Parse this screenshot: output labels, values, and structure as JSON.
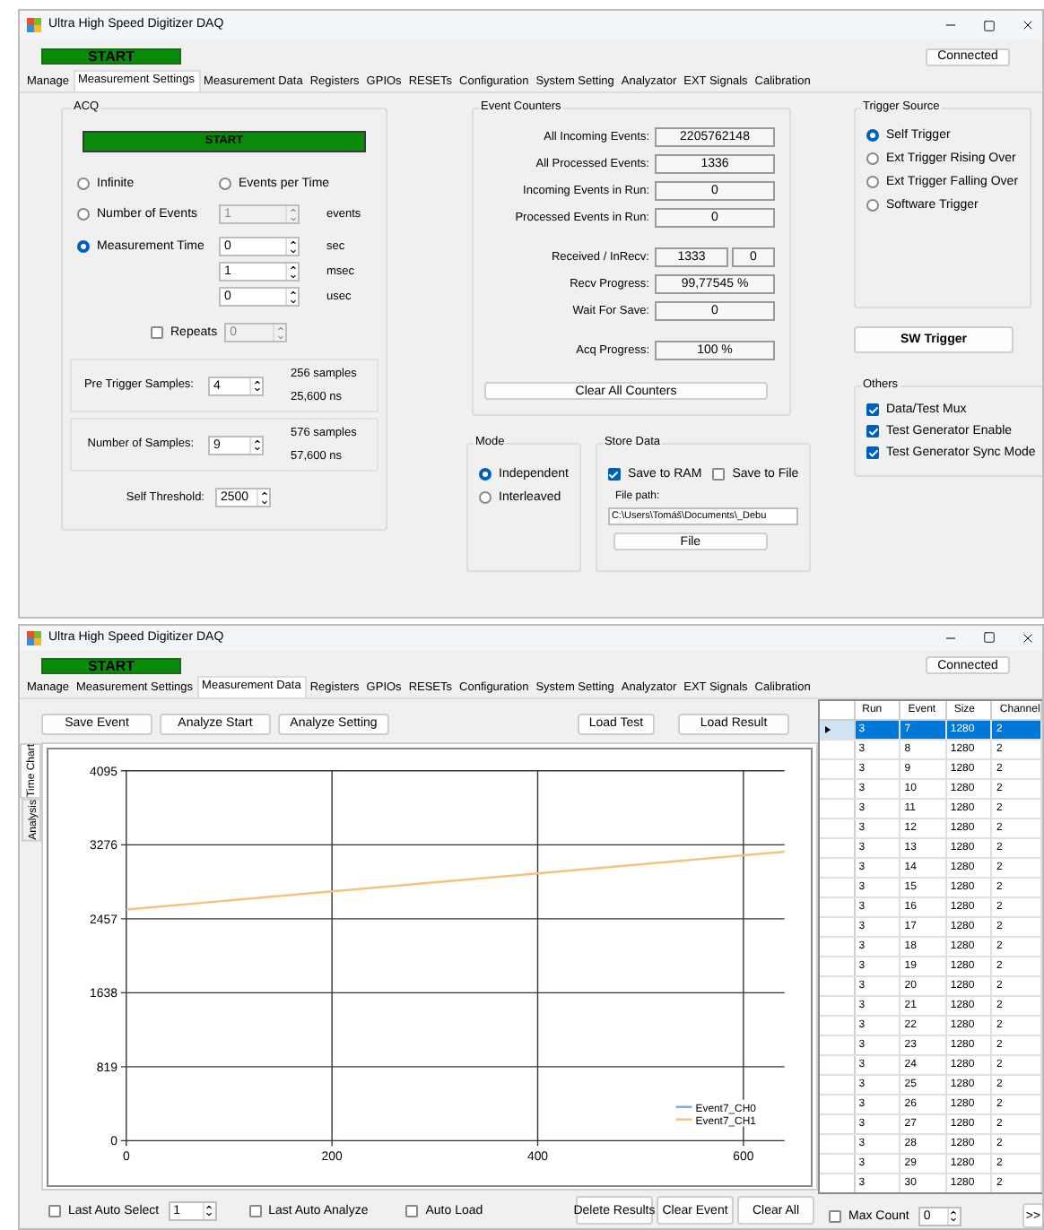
{
  "settings_window": {
    "title": "Ultra High Speed Digitizer DAQ",
    "start_button": "START",
    "connection_button": "Connected",
    "tabs": [
      {
        "label": "Manage",
        "selected": false
      },
      {
        "label": "Measurement Settings",
        "selected": true
      },
      {
        "label": "Measurement Data",
        "selected": false
      },
      {
        "label": "Registers",
        "selected": false
      },
      {
        "label": "GPIOs",
        "selected": false
      },
      {
        "label": "RESETs",
        "selected": false
      },
      {
        "label": "Configuration",
        "selected": false
      },
      {
        "label": "System Setting",
        "selected": false
      },
      {
        "label": "Analyzator",
        "selected": false
      },
      {
        "label": "EXT Signals",
        "selected": false
      },
      {
        "label": "Calibration",
        "selected": false
      }
    ],
    "acq": {
      "title": "ACQ",
      "start_button": "START",
      "modes": [
        {
          "label": "Infinite",
          "selected": false
        },
        {
          "label": "Events per Time",
          "selected": false
        },
        {
          "label": "Number of Events",
          "selected": false
        },
        {
          "label": "Measurement Time",
          "selected": true
        }
      ],
      "number_of_events": {
        "value": "1",
        "unit": "events",
        "disabled": true
      },
      "time": [
        {
          "value": "0",
          "unit": "sec"
        },
        {
          "value": "1",
          "unit": "msec"
        },
        {
          "value": "0",
          "unit": "usec"
        }
      ],
      "repeats": {
        "label": "Repeats",
        "checked": false,
        "value": "0",
        "disabled": true
      },
      "sample_boxes": [
        {
          "label": "Pre Trigger Samples:",
          "value": "4",
          "samples": "256 samples",
          "time": "25,600 ns"
        },
        {
          "label": "Number of Samples:",
          "value": "9",
          "samples": "576 samples",
          "time": "57,600 ns"
        }
      ],
      "threshold": {
        "label": "Self Threshold:",
        "value": "2500"
      }
    },
    "event_counters": {
      "title": "Event Counters",
      "groups": [
        [
          {
            "label": "All Incoming Events:",
            "values": [
              "2205762148"
            ]
          },
          {
            "label": "All Processed Events:",
            "values": [
              "1336"
            ]
          },
          {
            "label": "Incoming Events in Run:",
            "values": [
              "0"
            ]
          },
          {
            "label": "Processed Events in Run:",
            "values": [
              "0"
            ]
          }
        ],
        [
          {
            "label": "Received / InRecv:",
            "values": [
              "1333",
              "0"
            ]
          },
          {
            "label": "Recv Progress:",
            "values": [
              "99,77545 %"
            ]
          },
          {
            "label": "Wait For Save:",
            "values": [
              "0"
            ]
          }
        ],
        [
          {
            "label": "Acq Progress:",
            "values": [
              "100 %"
            ]
          }
        ]
      ],
      "clear_button": "Clear All Counters"
    },
    "mode": {
      "title": "Mode",
      "options": [
        {
          "label": "Independent",
          "selected": true
        },
        {
          "label": "Interleaved",
          "selected": false
        }
      ]
    },
    "store_data": {
      "title": "Store Data",
      "options": [
        {
          "label": "Save to RAM",
          "checked": true
        },
        {
          "label": "Save to File",
          "checked": false
        }
      ],
      "file_path_label": "File path:",
      "file_path": "C:\\Users\\Tomáš\\Documents\\_Debu",
      "file_button": "File"
    },
    "trigger_source": {
      "title": "Trigger Source",
      "options": [
        {
          "label": "Self Trigger",
          "selected": true
        },
        {
          "label": "Ext Trigger Rising Over",
          "selected": false
        },
        {
          "label": "Ext Trigger Falling Over",
          "selected": false
        },
        {
          "label": "Software Trigger",
          "selected": false
        }
      ]
    },
    "sw_trigger_button": "SW Trigger",
    "others": {
      "title": "Others",
      "options": [
        {
          "label": "Data/Test Mux",
          "checked": true
        },
        {
          "label": "Test Generator Enable",
          "checked": true
        },
        {
          "label": "Test Generator Sync Mode",
          "checked": true
        }
      ]
    }
  },
  "data_window": {
    "title": "Ultra High Speed Digitizer DAQ",
    "start_button": "START",
    "connection_button": "Connected",
    "tabs": [
      {
        "label": "Manage",
        "selected": false
      },
      {
        "label": "Measurement Settings",
        "selected": false
      },
      {
        "label": "Measurement Data",
        "selected": true
      },
      {
        "label": "Registers",
        "selected": false
      },
      {
        "label": "GPIOs",
        "selected": false
      },
      {
        "label": "RESETs",
        "selected": false
      },
      {
        "label": "Configuration",
        "selected": false
      },
      {
        "label": "System Setting",
        "selected": false
      },
      {
        "label": "Analyzator",
        "selected": false
      },
      {
        "label": "EXT Signals",
        "selected": false
      },
      {
        "label": "Calibration",
        "selected": false
      }
    ],
    "toolbar_left": [
      "Save Event",
      "Analyze Start",
      "Analyze Setting"
    ],
    "toolbar_right": [
      "Load Test",
      "Load Result"
    ],
    "side_tabs": [
      {
        "label": "Time Chart",
        "selected": true
      },
      {
        "label": "Analysis",
        "selected": false
      }
    ],
    "chart": {
      "chart_data": {
        "type": "line",
        "x": [
          0,
          640
        ],
        "xlim": [
          0,
          640
        ],
        "ylim": [
          0,
          4095
        ],
        "xticks": [
          0,
          200,
          400,
          600
        ],
        "yticks": [
          0,
          819,
          1638,
          2457,
          3276,
          4095
        ],
        "grid": true,
        "legend": true,
        "series": [
          {
            "name": "Event7_CH0",
            "color": "#6fa8f0",
            "values": [
              null,
              null
            ]
          },
          {
            "name": "Event7_CH1",
            "color": "#f5c27a",
            "values": [
              2560,
              3200
            ]
          }
        ]
      }
    },
    "bottom_left": {
      "last_auto_select": {
        "label": "Last Auto Select",
        "checked": false,
        "value": "1"
      },
      "checks": [
        {
          "label": "Last Auto Analyze",
          "checked": false
        },
        {
          "label": "Auto Load",
          "checked": false
        }
      ],
      "buttons": [
        "Delete Results",
        "Clear Event",
        "Clear All"
      ]
    },
    "table": {
      "columns": [
        "Run",
        "Event",
        "Size",
        "Channel"
      ],
      "rows": [
        {
          "cells": [
            "3",
            "7",
            "1280",
            "2"
          ],
          "selected": true
        },
        {
          "cells": [
            "3",
            "8",
            "1280",
            "2"
          ],
          "selected": false
        },
        {
          "cells": [
            "3",
            "9",
            "1280",
            "2"
          ],
          "selected": false
        },
        {
          "cells": [
            "3",
            "10",
            "1280",
            "2"
          ],
          "selected": false
        },
        {
          "cells": [
            "3",
            "11",
            "1280",
            "2"
          ],
          "selected": false
        },
        {
          "cells": [
            "3",
            "12",
            "1280",
            "2"
          ],
          "selected": false
        },
        {
          "cells": [
            "3",
            "13",
            "1280",
            "2"
          ],
          "selected": false
        },
        {
          "cells": [
            "3",
            "14",
            "1280",
            "2"
          ],
          "selected": false
        },
        {
          "cells": [
            "3",
            "15",
            "1280",
            "2"
          ],
          "selected": false
        },
        {
          "cells": [
            "3",
            "16",
            "1280",
            "2"
          ],
          "selected": false
        },
        {
          "cells": [
            "3",
            "17",
            "1280",
            "2"
          ],
          "selected": false
        },
        {
          "cells": [
            "3",
            "18",
            "1280",
            "2"
          ],
          "selected": false
        },
        {
          "cells": [
            "3",
            "19",
            "1280",
            "2"
          ],
          "selected": false
        },
        {
          "cells": [
            "3",
            "20",
            "1280",
            "2"
          ],
          "selected": false
        },
        {
          "cells": [
            "3",
            "21",
            "1280",
            "2"
          ],
          "selected": false
        },
        {
          "cells": [
            "3",
            "22",
            "1280",
            "2"
          ],
          "selected": false
        },
        {
          "cells": [
            "3",
            "23",
            "1280",
            "2"
          ],
          "selected": false
        },
        {
          "cells": [
            "3",
            "24",
            "1280",
            "2"
          ],
          "selected": false
        },
        {
          "cells": [
            "3",
            "25",
            "1280",
            "2"
          ],
          "selected": false
        },
        {
          "cells": [
            "3",
            "26",
            "1280",
            "2"
          ],
          "selected": false
        },
        {
          "cells": [
            "3",
            "27",
            "1280",
            "2"
          ],
          "selected": false
        },
        {
          "cells": [
            "3",
            "28",
            "1280",
            "2"
          ],
          "selected": false
        },
        {
          "cells": [
            "3",
            "29",
            "1280",
            "2"
          ],
          "selected": false
        },
        {
          "cells": [
            "3",
            "30",
            "1280",
            "2"
          ],
          "selected": false
        }
      ]
    },
    "max_count": {
      "label": "Max Count",
      "checked": false,
      "value": "0"
    },
    "more_button": ">>"
  }
}
